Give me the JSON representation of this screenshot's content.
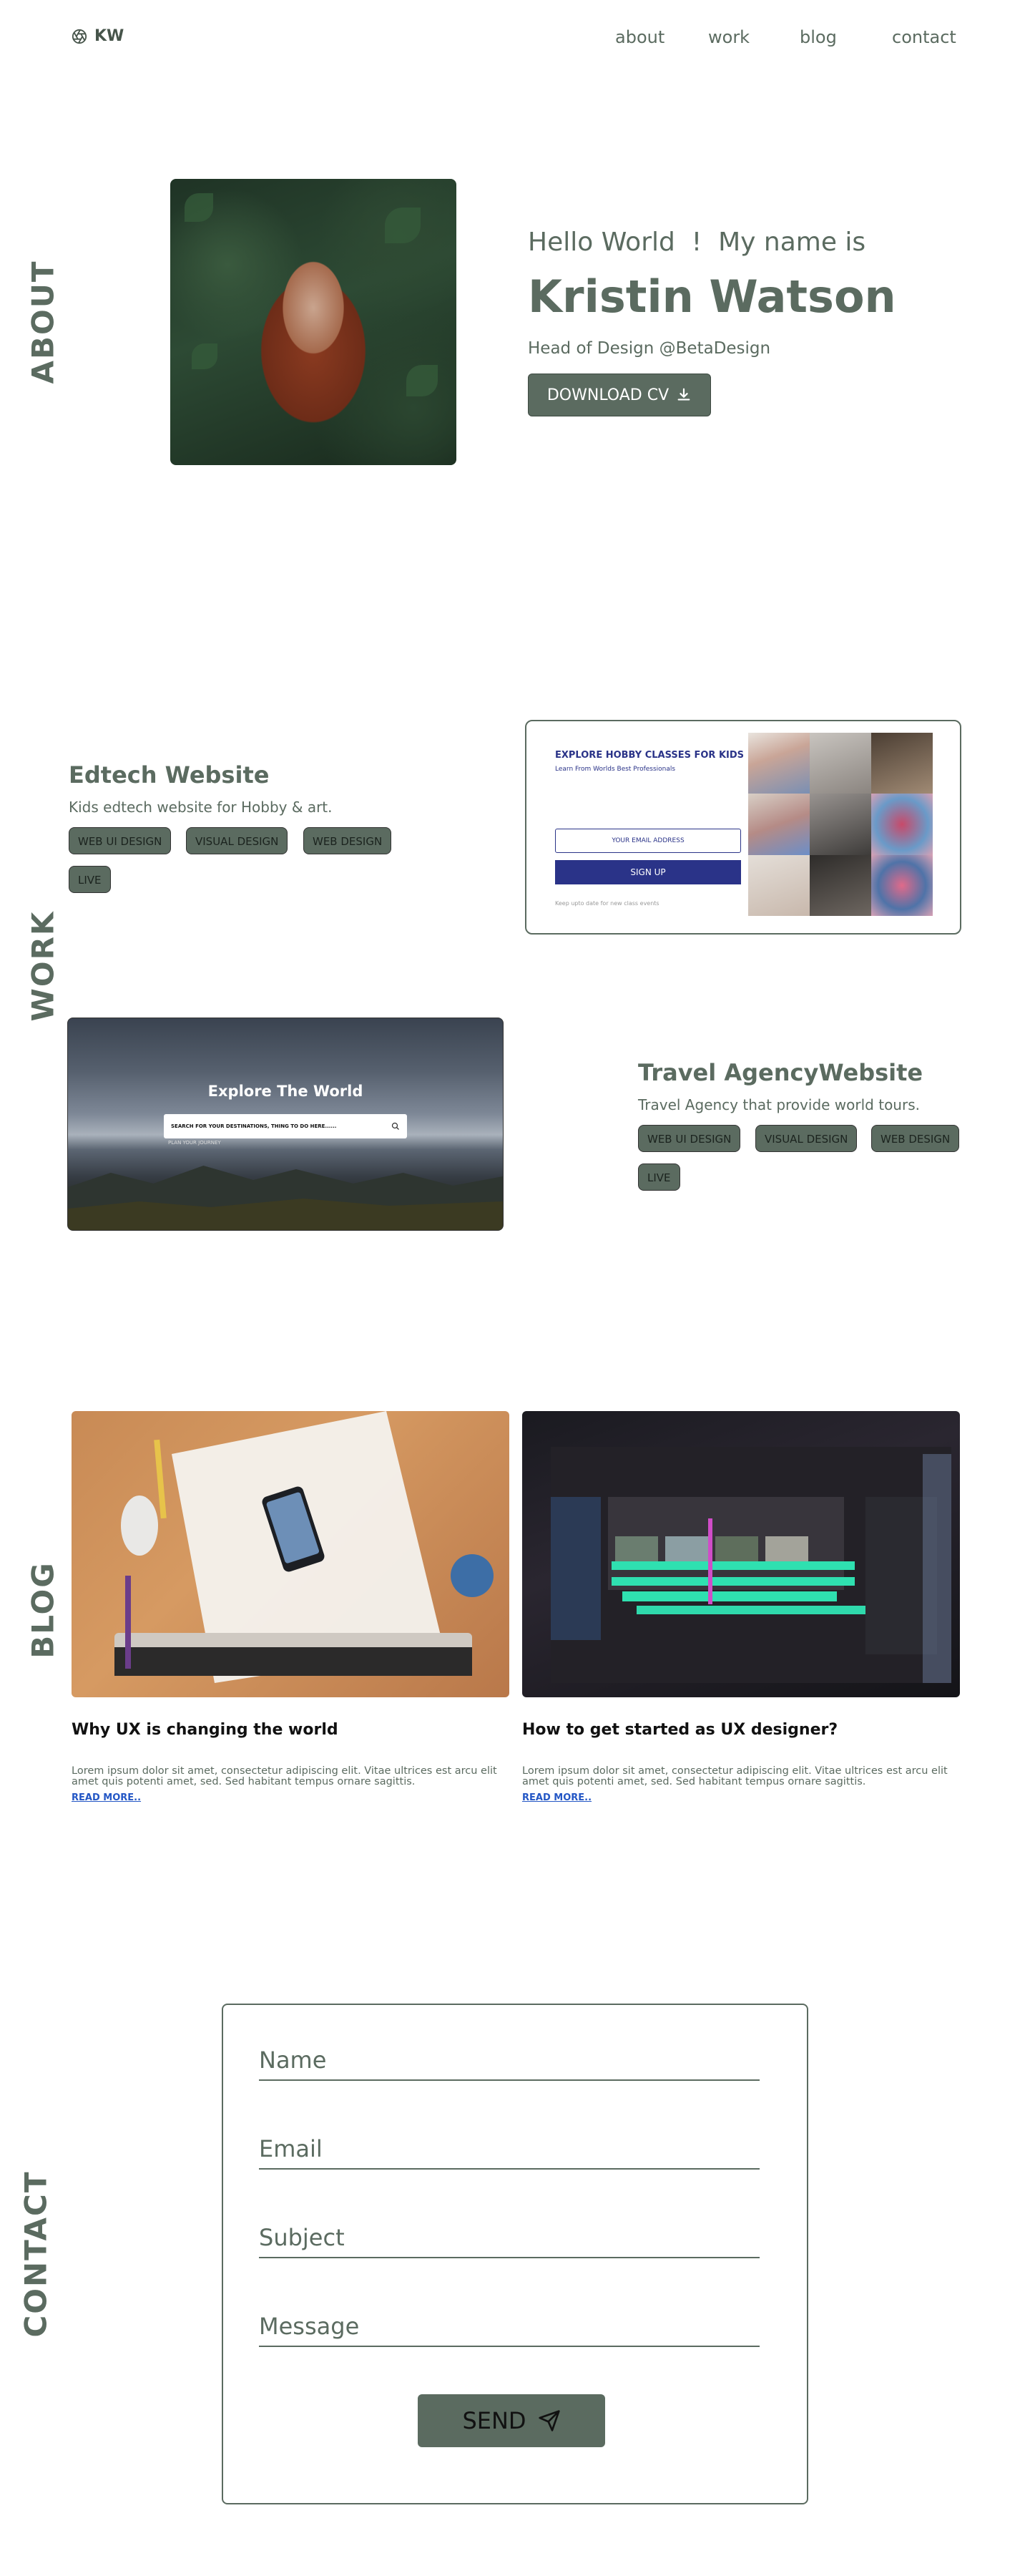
{
  "nav": {
    "brand": "KW",
    "links": [
      "about",
      "work",
      "blog",
      "contact"
    ]
  },
  "sections": {
    "about": "ABOUT",
    "work": "WORK",
    "blog": "BLOG",
    "contact": "CONTACT"
  },
  "about": {
    "greeting": "Hello World  !  My name is",
    "name": "Kristin Watson",
    "role": "Head of Design @BetaDesign",
    "cv_button": "DOWNLOAD CV"
  },
  "work": {
    "projects": [
      {
        "title": "Edtech Website",
        "description": "Kids edtech website for Hobby & art.",
        "tags": [
          "WEB UI DESIGN",
          "VISUAL DESIGN",
          "WEB DESIGN",
          "LIVE"
        ],
        "preview": {
          "heading": "EXPLORE HOBBY CLASSES FOR KIDS",
          "subheading": "Learn From Worlds Best Professionals",
          "input_placeholder": "YOUR EMAIL ADDRESS",
          "button": "SIGN UP",
          "checkbox": "Keep upto date for new class events"
        }
      },
      {
        "title": "Travel AgencyWebsite",
        "description": "Travel Agency that provide world tours.",
        "tags": [
          "WEB UI DESIGN",
          "VISUAL DESIGN",
          "WEB DESIGN",
          "LIVE"
        ],
        "preview": {
          "heading": "Explore The World",
          "search_placeholder": "SEARCH FOR YOUR DESTINATIONS, THING TO DO HERE......",
          "location": "PLAN YOUR JOURNEY"
        }
      }
    ]
  },
  "blog": {
    "posts": [
      {
        "title": "Why UX is changing the world",
        "excerpt": "Lorem ipsum dolor sit amet, consectetur adipiscing elit. Vitae ultrices est arcu elit amet quis potenti amet, sed. Sed habitant tempus ornare sagittis.",
        "link": "READ MORE.."
      },
      {
        "title": "How to get started as UX designer?",
        "excerpt": "Lorem ipsum dolor sit amet, consectetur adipiscing elit. Vitae ultrices est arcu elit amet quis potenti amet, sed. Sed habitant tempus ornare sagittis.",
        "link": "READ MORE.."
      }
    ]
  },
  "contact": {
    "fields": [
      "Name",
      "Email",
      "Subject",
      "Message"
    ],
    "send_button": "SEND"
  },
  "colors": {
    "accent": "#5b6b60",
    "mock_brand": "#2a3388",
    "link": "#2457c5"
  }
}
